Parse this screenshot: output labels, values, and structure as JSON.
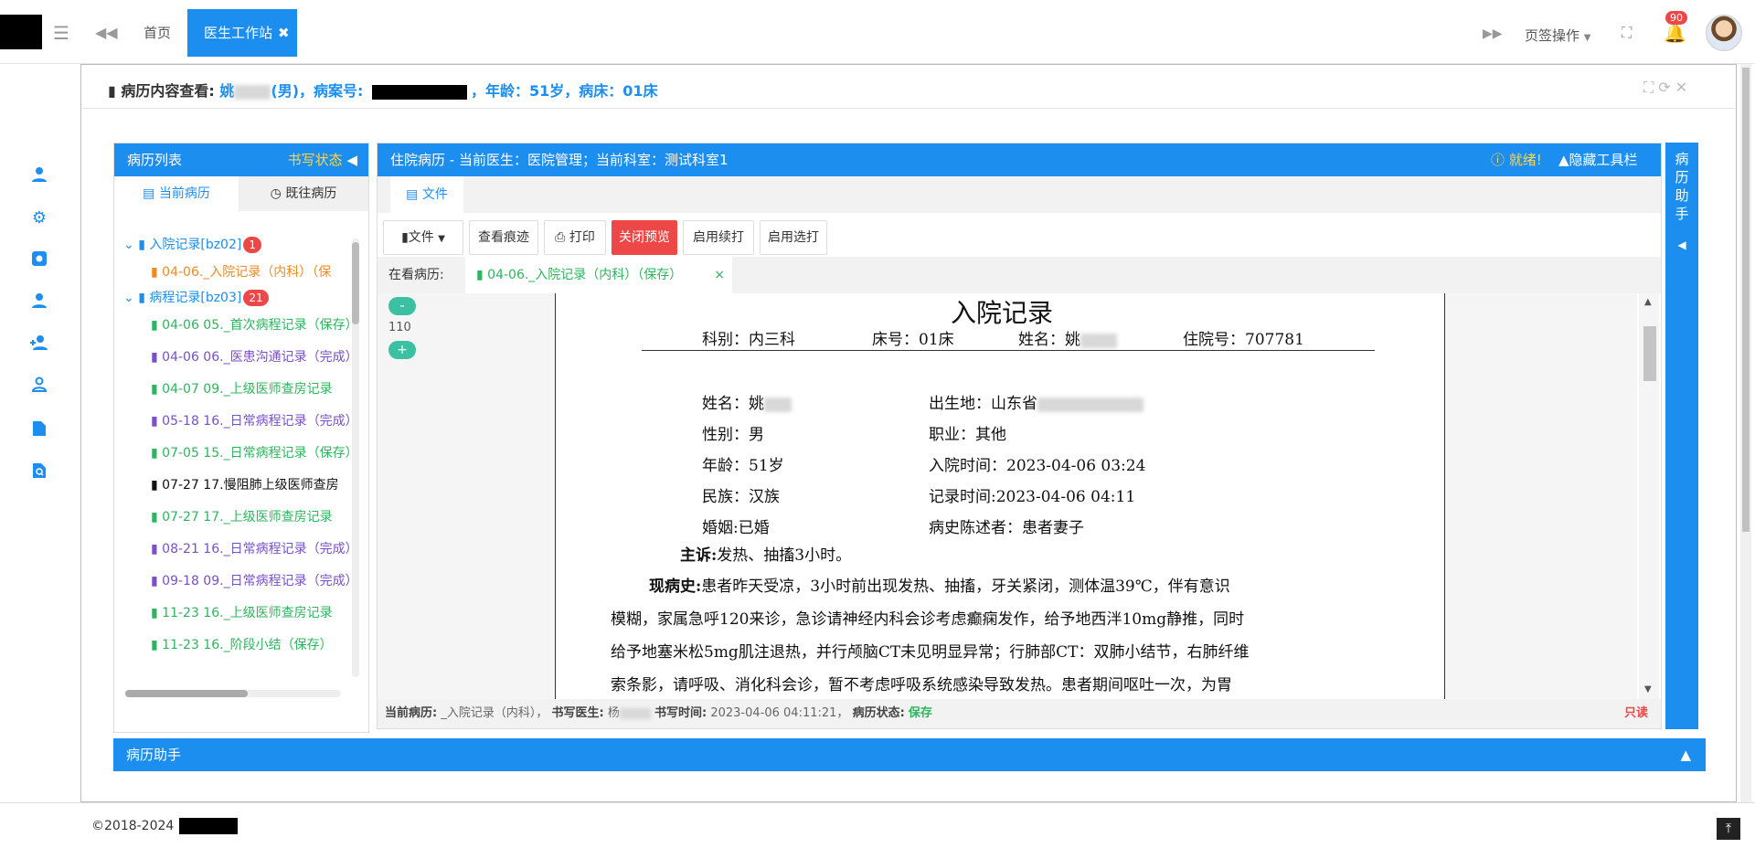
{
  "topbar": {
    "home_tab": "首页",
    "active_tab": "医生工作站",
    "active_tab_close": "✖",
    "page_ops": "页签操作",
    "notifications_count": "90",
    "icons": [
      "menu-icon",
      "backward-icon",
      "forward-icon",
      "fullscreen-icon",
      "bell-icon",
      "avatar"
    ]
  },
  "sidebar": {
    "icons": [
      "user-icon",
      "gear-icon",
      "settings-box-icon",
      "user-icon",
      "user-add-icon",
      "user-outline-icon",
      "document-icon",
      "search-document-icon"
    ]
  },
  "panel": {
    "title_label": "病历内容查看:",
    "patient_name": "姚",
    "gender": "(男)，病案号:",
    "age_bed": "，年龄：51岁，病床：01床"
  },
  "record_list": {
    "header": "病历列表",
    "write_status": "书写状态",
    "tab_current": "当前病历",
    "tab_past": "既往病历",
    "groups": [
      {
        "label": "入院记录[bz02]",
        "count": "1",
        "items": [
          {
            "label": "04-06._入院记录（内科）（保",
            "color": "#f08a24"
          }
        ]
      },
      {
        "label": "病程记录[bz03]",
        "count": "21",
        "items": [
          {
            "label": "04-06 05._首次病程记录（保存）",
            "color": "#2db55d"
          },
          {
            "label": "04-06 06._医患沟通记录（完成）",
            "color": "#7b4fc7"
          },
          {
            "label": "04-07 09._上级医师查房记录",
            "color": "#2db55d"
          },
          {
            "label": "05-18 16._日常病程记录（完成）",
            "color": "#7b4fc7"
          },
          {
            "label": "07-05 15._日常病程记录（保存）",
            "color": "#2db55d"
          },
          {
            "label": "07-27 17.慢阻肺上级医师查房",
            "color": "#111111"
          },
          {
            "label": "07-27 17._上级医师查房记录",
            "color": "#2db55d"
          },
          {
            "label": "08-21 16._日常病程记录（完成）",
            "color": "#7b4fc7"
          },
          {
            "label": "09-18 09._日常病程记录（完成）",
            "color": "#7b4fc7"
          },
          {
            "label": "11-23 16._上级医师查房记录",
            "color": "#2db55d"
          },
          {
            "label": "11-23 16._阶段小结（保存）",
            "color": "#2db55d"
          }
        ]
      }
    ]
  },
  "doc": {
    "header": "住院病历 - 当前医生：医院管理；当前科室：测试科室1",
    "ready": "就绪!",
    "hide_toolbar": "隐藏工具栏",
    "file_tab": "文件",
    "toolbar": {
      "file": "文件",
      "view_trace": "查看痕迹",
      "print": "打印",
      "close_preview": "关闭预览",
      "continue_print": "启用续打",
      "select_print": "启用选打"
    },
    "viewing_label": "在看病历:",
    "viewing_tab": "04-06._入院记录（内科）（保存）",
    "viewing_close": "×",
    "zoom_minus": "-",
    "zoom_value": "110",
    "zoom_plus": "+",
    "footer": {
      "cur_label": "当前病历:",
      "cur_value": "_入院记录（内科），",
      "doctor_label": "书写医生:",
      "doctor_value": "杨",
      "time_label": "书写时间:",
      "time_value": "2023-04-06 04:11:21，",
      "status_label": "病历状态:",
      "status_value": "保存",
      "readonly": "只读"
    }
  },
  "paper": {
    "title": "入院记录",
    "dept": "科别：内三科",
    "bed": "床号：01床",
    "name_head": "姓名：姚",
    "hosp_no": "住院号：707781",
    "name": "姓名：姚",
    "birthplace": "出生地：山东省",
    "gender": "性别：男",
    "job": "职业：其他",
    "age": "年龄：51岁",
    "admit_time": "入院时间：2023-04-06 03:24",
    "ethnic": "民族：汉族",
    "record_time": "记录时间:2023-04-06 04:11",
    "marriage": "婚姻:已婚",
    "narrator": "病史陈述者：患者妻子",
    "complaint_label": "主诉:",
    "complaint": "发热、抽搐3小时。",
    "history_label": "现病史:",
    "history_lines": [
      "患者昨天受凉，3小时前出现发热、抽搐，牙关紧闭，测体温39℃，伴有意识",
      "模糊，家属急呼120来诊，急诊请神经内科会诊考虑癫痫发作，给予地西泮10mg静推，同时",
      "给予地塞米松5mg肌注退热，并行颅脑CT未见明显异常；行肺部CT：双肺小结节，右肺纤维",
      "索条影，请呼吸、消化科会诊，暂不考虑呼吸系统感染导致发热。患者期间呕吐一次，为胃"
    ]
  },
  "assistant": {
    "side_label": [
      "病",
      "历",
      "助",
      "手"
    ],
    "side_arrow": "◀",
    "bottom_label": "病历助手",
    "bottom_arrow": "▲"
  },
  "footer": {
    "copyright": "©2018-2024"
  },
  "colors": {
    "accent": "#1c8ef0",
    "danger": "#ed4747",
    "success": "#2db55d",
    "warning": "#ffd54a"
  }
}
